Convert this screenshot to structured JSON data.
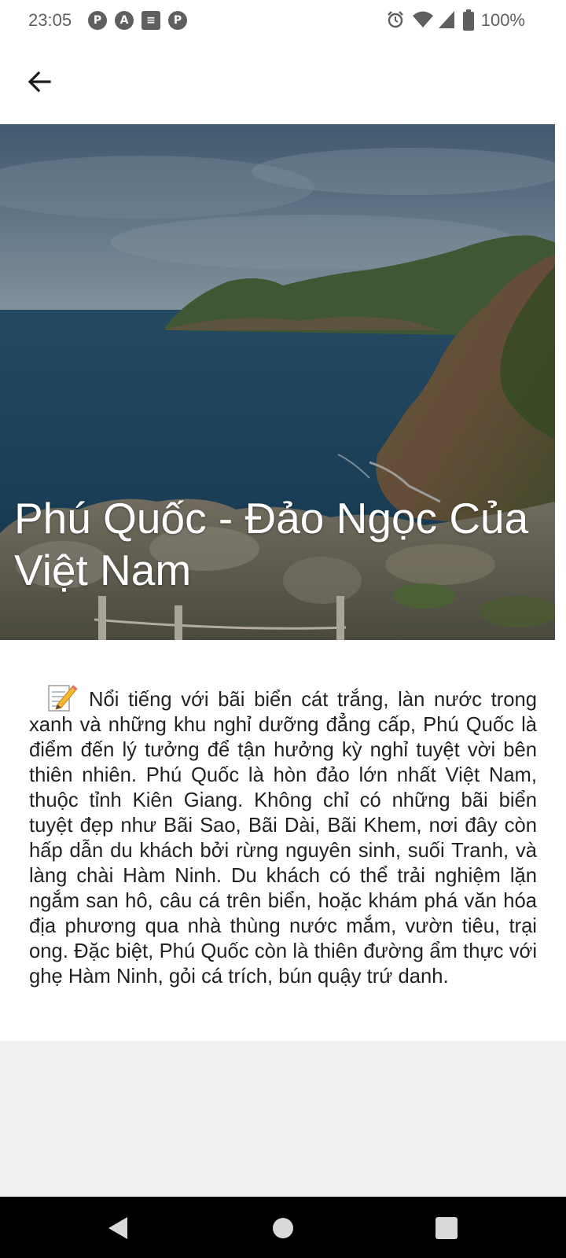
{
  "status_bar": {
    "time": "23:05",
    "battery": "100%",
    "notification_icons": [
      "pocket-casts-icon",
      "a-icon",
      "news-icon",
      "pocket-casts-icon"
    ],
    "system_icons": [
      "alarm-icon",
      "wifi-icon",
      "signal-icon",
      "battery-icon"
    ]
  },
  "app_bar": {
    "back_icon": "arrow-left-icon"
  },
  "hero": {
    "title": "Phú Quốc - Đảo Ngọc Của Việt Nam"
  },
  "article": {
    "icon": "memo-icon",
    "body": "Nổi tiếng với bãi biển cát trắng, làn nước trong xanh và những khu nghỉ dưỡng đẳng cấp, Phú Quốc là điểm đến lý tưởng để tận hưởng kỳ nghỉ tuyệt vời bên thiên nhiên. Phú Quốc là hòn đảo lớn nhất Việt Nam, thuộc tỉnh Kiên Giang. Không chỉ có những bãi biển tuyệt đẹp như Bãi Sao, Bãi Dài, Bãi Khem, nơi đây còn hấp dẫn du khách bởi rừng nguyên sinh, suối Tranh, và làng chài Hàm Ninh. Du khách có thể trải nghiệm lặn ngắm san hô, câu cá trên biển, hoặc khám phá văn hóa địa phương qua nhà thùng nước mắm, vườn tiêu, trại ong. Đặc biệt, Phú Quốc còn là thiên đường ẩm thực với ghẹ Hàm Ninh, gỏi cá trích, bún quậy trứ danh."
  },
  "nav_bar": {
    "buttons": [
      "back-triangle-icon",
      "home-circle-icon",
      "recents-square-icon"
    ]
  },
  "colors": {
    "status_text": "#5f5f5f",
    "body_text": "#222222",
    "filler": "#f1f1f1",
    "nav_bar": "#000000"
  }
}
